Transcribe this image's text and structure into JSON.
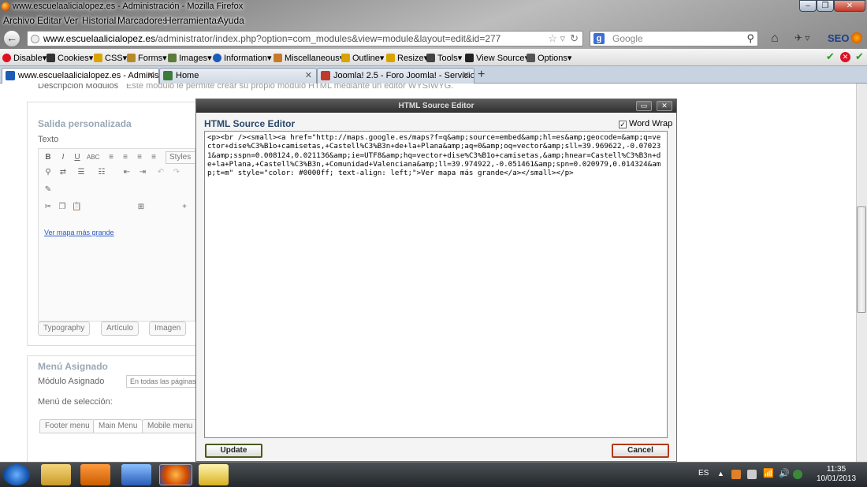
{
  "window": {
    "title": "www.escuelaalicialopez.es - Administración - Mozilla Firefox"
  },
  "menu": [
    "Archivo",
    "Editar",
    "Ver",
    "Historial",
    "Marcadores",
    "Herramientas",
    "Ayuda"
  ],
  "nav": {
    "url_domain": "www.escuelaalicialopez.es",
    "url_path": "/administrator/index.php?option=com_modules&view=module&layout=edit&id=277",
    "search_placeholder": "Google",
    "seo_label": "SEO"
  },
  "webdev_toolbar": [
    "Disable",
    "Cookies",
    "CSS",
    "Forms",
    "Images",
    "Information",
    "Miscellaneous",
    "Outline",
    "Resize",
    "Tools",
    "View Source",
    "Options"
  ],
  "tabs": [
    {
      "label": "www.escuelaalicialopez.es - Administ...",
      "active": true
    },
    {
      "label": "Home",
      "active": false
    },
    {
      "label": "Joomla! 2.5 - Foro Joomla! - Servicios ...",
      "active": false
    }
  ],
  "page": {
    "desc_label": "Descripción Módulos",
    "desc_text": "Este módulo le permite crear su propio módulo HTML mediante un editor WYSIWYG.",
    "custom_output_title": "Salida personalizada",
    "text_label": "Texto",
    "styles_label": "Styles",
    "link_text": "Ver mapa más grande",
    "typography_btn": "Typography",
    "article_btn": "Artículo",
    "image_btn": "Imagen",
    "assigned_menu_title": "Menú Asignado",
    "assigned_module_label": "Módulo Asignado",
    "assigned_module_value": "En todas las páginas",
    "menu_selection_label": "Menú de selección:",
    "menu_tabs": [
      "Footer menu",
      "Main Menu",
      "Mobile menu"
    ]
  },
  "modal": {
    "header": "HTML Source Editor",
    "title": "HTML Source Editor",
    "word_wrap_label": "Word Wrap",
    "word_wrap_checked": true,
    "source": "<p><br /><small><a href=\"http://maps.google.es/maps?f=q&amp;source=embed&amp;hl=es&amp;geocode=&amp;q=vector+dise%C3%B1o+camisetas,+Castell%C3%B3n+de+la+Plana&amp;aq=0&amp;oq=vector&amp;sll=39.969622,-0.070231&amp;sspn=0.008124,0.021136&amp;ie=UTF8&amp;hq=vector+dise%C3%B1o+camisetas,&amp;hnear=Castell%C3%B3n+de+la+Plana,+Castell%C3%B3n,+Comunidad+Valenciana&amp;ll=39.974922,-0.051461&amp;spn=0.020979,0.014324&amp;t=m\" style=\"color: #0000ff; text-align: left;\">Ver mapa más grande</a></small></p>",
    "update_label": "Update",
    "cancel_label": "Cancel"
  },
  "taskbar": {
    "lang": "ES",
    "time": "11:35",
    "date": "10/01/2013"
  }
}
